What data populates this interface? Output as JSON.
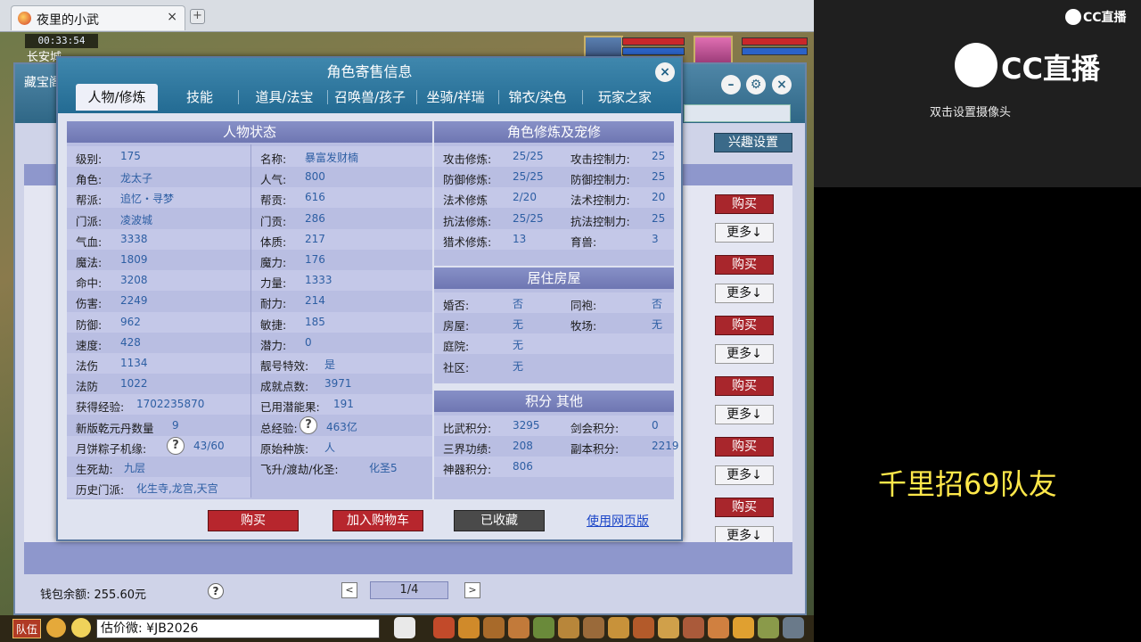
{
  "browser": {
    "tab_title": "夜里的小武",
    "tab_close": "×",
    "new_tab": "+"
  },
  "hud": {
    "time": "00:33:54",
    "location": "长安城"
  },
  "market": {
    "title": "藏宝阁",
    "interest_label": "兴趣设置",
    "buy_label": "购买",
    "more_label": "更多↓",
    "wallet": "钱包余额: 255.60元",
    "page": "1/4",
    "prev": "<",
    "next": ">",
    "help": "?"
  },
  "dialog": {
    "title": "角色寄售信息",
    "close": "×",
    "tabs": [
      "人物/修炼",
      "技能",
      "道具/法宝",
      "召唤兽/孩子",
      "坐骑/祥瑞",
      "锦衣/染色",
      "玩家之家"
    ],
    "status": {
      "header": "人物状态",
      "left": [
        {
          "label": "级别:",
          "value": "175"
        },
        {
          "label": "角色:",
          "value": "龙太子"
        },
        {
          "label": "帮派:",
          "value": "追忆・寻梦"
        },
        {
          "label": "门派:",
          "value": "凌波城"
        },
        {
          "label": "气血:",
          "value": "3338"
        },
        {
          "label": "魔法:",
          "value": "1809"
        },
        {
          "label": "命中:",
          "value": "3208"
        },
        {
          "label": "伤害:",
          "value": "2249"
        },
        {
          "label": "防御:",
          "value": "962"
        },
        {
          "label": "速度:",
          "value": "428"
        },
        {
          "label": "法伤",
          "value": "1134"
        },
        {
          "label": "法防",
          "value": "1022"
        },
        {
          "label": "获得经验:",
          "value": "1702235870"
        },
        {
          "label": "新版乾元丹数量",
          "value": "9"
        },
        {
          "label": "月饼粽子机缘:",
          "value": "43/60"
        },
        {
          "label": "生死劫:",
          "value": "九层"
        },
        {
          "label": "历史门派:",
          "value": "化生寺,龙宫,天宫"
        }
      ],
      "right": [
        {
          "label": "名称:",
          "value": "暴富发财楠"
        },
        {
          "label": "人气:",
          "value": "800"
        },
        {
          "label": "帮贡:",
          "value": "616"
        },
        {
          "label": "门贡:",
          "value": "286"
        },
        {
          "label": "体质:",
          "value": "217"
        },
        {
          "label": "魔力:",
          "value": "176"
        },
        {
          "label": "力量:",
          "value": "1333"
        },
        {
          "label": "耐力:",
          "value": "214"
        },
        {
          "label": "敏捷:",
          "value": "185"
        },
        {
          "label": "潜力:",
          "value": "0"
        },
        {
          "label": "靓号特效:",
          "value": "是"
        },
        {
          "label": "成就点数:",
          "value": "3971"
        },
        {
          "label": "已用潜能果:",
          "value": "191"
        },
        {
          "label": "总经验:",
          "value": "463亿"
        },
        {
          "label": "原始种族:",
          "value": "人"
        },
        {
          "label": "飞升/渡劫/化圣:",
          "value": "化圣5"
        }
      ]
    },
    "cultivation": {
      "header": "角色修炼及宠修",
      "rows": [
        {
          "l1": "攻击修炼:",
          "v1": "25/25",
          "l2": "攻击控制力:",
          "v2": "25"
        },
        {
          "l1": "防御修炼:",
          "v1": "25/25",
          "l2": "防御控制力:",
          "v2": "25"
        },
        {
          "l1": "法术修炼",
          "v1": "2/20",
          "l2": "法术控制力:",
          "v2": "20"
        },
        {
          "l1": "抗法修炼:",
          "v1": "25/25",
          "l2": "抗法控制力:",
          "v2": "25"
        },
        {
          "l1": "猎术修炼:",
          "v1": "13",
          "l2": "育兽:",
          "v2": "3"
        }
      ]
    },
    "housing": {
      "header": "居住房屋",
      "rows": [
        {
          "l1": "婚否:",
          "v1": "否",
          "l2": "同袍:",
          "v2": "否"
        },
        {
          "l1": "房屋:",
          "v1": "无",
          "l2": "牧场:",
          "v2": "无"
        },
        {
          "l1": "庭院:",
          "v1": "无",
          "l2": "",
          "v2": ""
        },
        {
          "l1": "社区:",
          "v1": "无",
          "l2": "",
          "v2": ""
        }
      ]
    },
    "points": {
      "header": "积分 其他",
      "rows": [
        {
          "l1": "比武积分:",
          "v1": "3295",
          "l2": "剑会积分:",
          "v2": "0"
        },
        {
          "l1": "三界功绩:",
          "v1": "208",
          "l2": "副本积分:",
          "v2": "2219"
        },
        {
          "l1": "神器积分:",
          "v1": "806",
          "l2": "",
          "v2": ""
        }
      ]
    },
    "help": "?",
    "buttons": {
      "buy": "购买",
      "add_cart": "加入购物车",
      "favorited": "已收藏",
      "web": "使用网页版"
    }
  },
  "bottom": {
    "team": "队伍",
    "chat_text": "估价微: ¥JB2026"
  },
  "sidebar": {
    "brand_small": "CC直播",
    "brand_big": "CC直播",
    "camera_hint": "双击设置摄像头",
    "promo": "千里招69队友"
  },
  "colors": {
    "dialog_header": "#236b93",
    "panel_header": "#6e76b2",
    "buy_red": "#b7262d",
    "value_blue": "#2d5ea3",
    "promo_yellow": "#ffe84a"
  }
}
